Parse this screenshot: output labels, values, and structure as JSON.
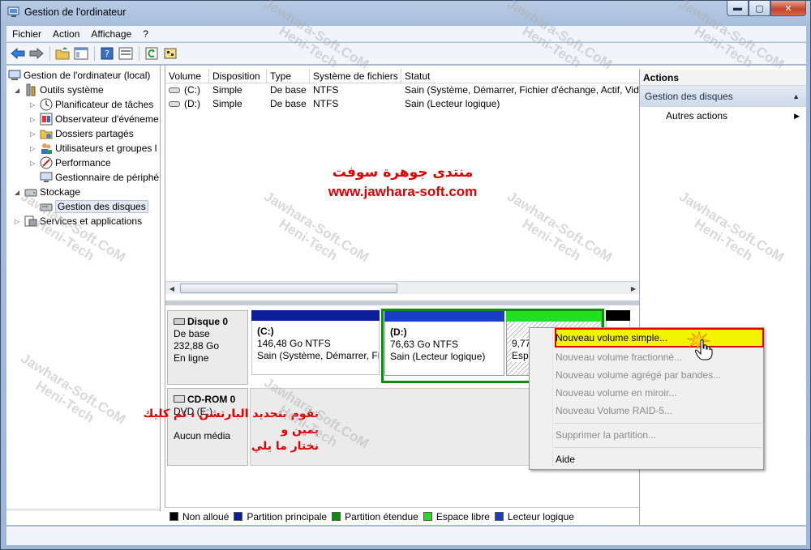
{
  "window": {
    "title": "Gestion de l'ordinateur",
    "minimize": "▬",
    "maximize": "▢",
    "close": "✕"
  },
  "menu": [
    "Fichier",
    "Action",
    "Affichage",
    "?"
  ],
  "tree": [
    {
      "label": "Gestion de l'ordinateur (local)",
      "icon": "computer-icon",
      "level": 0,
      "exp": ""
    },
    {
      "label": "Outils système",
      "icon": "tools-icon",
      "level": 1,
      "exp": "◢"
    },
    {
      "label": "Planificateur de tâches",
      "icon": "clock-icon",
      "level": 2,
      "exp": "▷"
    },
    {
      "label": "Observateur d'événeme",
      "icon": "event-viewer-icon",
      "level": 2,
      "exp": "▷"
    },
    {
      "label": "Dossiers partagés",
      "icon": "shared-folder-icon",
      "level": 2,
      "exp": "▷"
    },
    {
      "label": "Utilisateurs et groupes l",
      "icon": "users-icon",
      "level": 2,
      "exp": "▷"
    },
    {
      "label": "Performance",
      "icon": "performance-icon",
      "level": 2,
      "exp": "▷"
    },
    {
      "label": "Gestionnaire de périphé",
      "icon": "device-manager-icon",
      "level": 2,
      "exp": ""
    },
    {
      "label": "Stockage",
      "icon": "storage-icon",
      "level": 1,
      "exp": "◢"
    },
    {
      "label": "Gestion des disques",
      "icon": "disk-management-icon",
      "level": 2,
      "exp": "",
      "selected": true
    },
    {
      "label": "Services et applications",
      "icon": "services-icon",
      "level": 1,
      "exp": "▷"
    }
  ],
  "volumes": {
    "columns": [
      "Volume",
      "Disposition",
      "Type",
      "Système de fichiers",
      "Statut"
    ],
    "rows": [
      [
        "(C:)",
        "Simple",
        "De base",
        "NTFS",
        "Sain (Système, Démarrer, Fichier d'échange, Actif, Vid"
      ],
      [
        "(D:)",
        "Simple",
        "De base",
        "NTFS",
        "Sain (Lecteur logique)"
      ]
    ]
  },
  "promo": {
    "arabic": "منتدى جوهرة سوفت",
    "url": "www.jawhara-soft.com"
  },
  "disk0": {
    "name": "Disque 0",
    "type": "De base",
    "size": "232,88 Go",
    "state": "En ligne"
  },
  "partC": {
    "name": "(C:)",
    "size": "146,48 Go NTFS",
    "status": "Sain (Système, Démarrer, Fi"
  },
  "partD": {
    "name": "(D:)",
    "size": "76,63 Go NTFS",
    "status": "Sain (Lecteur logique)"
  },
  "partFree": {
    "size": "9,77",
    "status": "Espa"
  },
  "cdrom": {
    "name": "CD-ROM 0",
    "drive": "DVD (E:)",
    "media": "Aucun média"
  },
  "note_ar": [
    "نقوم بتحديد البارتشن ، ثم كليك يمين و",
    "نختار ما يلي"
  ],
  "legend": [
    {
      "label": "Non alloué",
      "color": "#000000"
    },
    {
      "label": "Partition principale",
      "color": "#0a1e9a"
    },
    {
      "label": "Partition étendue",
      "color": "#108a10"
    },
    {
      "label": "Espace libre",
      "color": "#20e020"
    },
    {
      "label": "Lecteur logique",
      "color": "#1a3ec8"
    }
  ],
  "actions": {
    "header": "Actions",
    "section": "Gestion des disques",
    "item": "Autres actions"
  },
  "context_menu": [
    {
      "label": "Nouveau volume simple...",
      "enabled": true
    },
    {
      "label": "Nouveau volume fractionné...",
      "enabled": false
    },
    {
      "label": "Nouveau volume agrégé par bandes...",
      "enabled": false
    },
    {
      "label": "Nouveau volume en miroir...",
      "enabled": false
    },
    {
      "label": "Nouveau Volume RAID-5...",
      "enabled": false
    },
    {
      "label": "Supprimer la partition...",
      "enabled": false
    },
    {
      "label": "Aide",
      "enabled": true
    }
  ],
  "watermark": {
    "line1": "Jawhara-Soft.CoM",
    "line2": "Heni-Tech"
  },
  "colors": {
    "primary": "#0a1e9a",
    "extended": "#108a10",
    "free": "#20e020",
    "logical": "#1a3ec8",
    "highlight": "#f3f300",
    "annotation": "#e00000"
  }
}
